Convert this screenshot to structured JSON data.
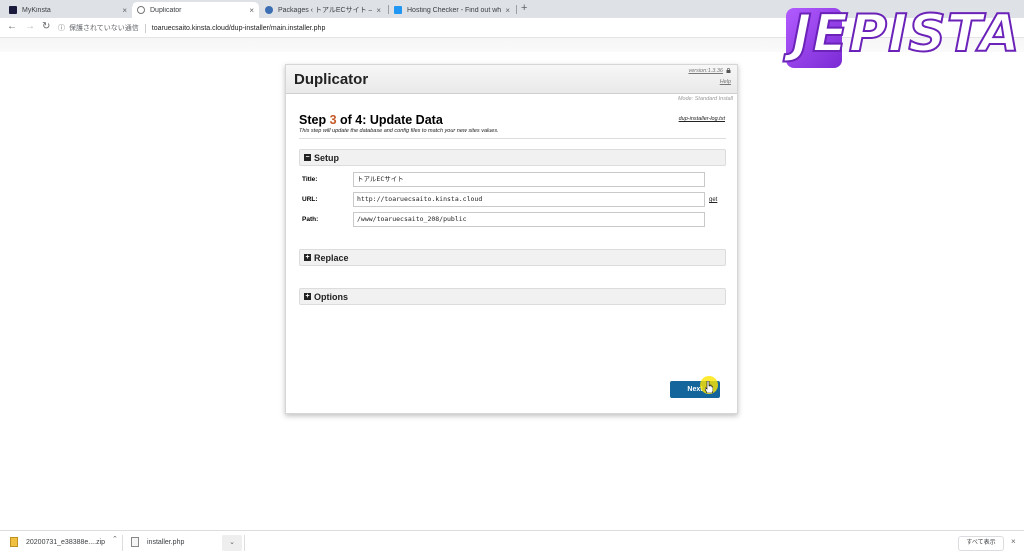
{
  "browser": {
    "tabs": [
      {
        "title": "MyKinsta",
        "fav_color": "#1a1a3d"
      },
      {
        "title": "Duplicator",
        "fav_color": "#ffffff"
      },
      {
        "title": "Packages ‹ トアルECサイト — Wor…",
        "fav_color": "#3c6eb4"
      },
      {
        "title": "Hosting Checker - Find out who…",
        "fav_color": "#2196f3"
      }
    ],
    "new_tab_icon": "plus-icon",
    "close_glyph": "×",
    "security_text": "保護されていない通信",
    "url": "toaruecsaito.kinsta.cloud/dup-installer/main.installer.php"
  },
  "logo": {
    "text": "JEPISTA"
  },
  "installer": {
    "brand": "Duplicator",
    "version": "version:1.3.36",
    "help": "Help",
    "mode": "Mode: Standard Install",
    "step_prefix": "Step ",
    "step_num": "3",
    "step_suffix": " of 4: Update Data",
    "step_desc": "This step will update the database and config files to match your new sites values.",
    "log_link": "dup-installer-log.txt",
    "sections": {
      "setup": {
        "icon": "−",
        "label": "Setup"
      },
      "replace": {
        "icon": "+",
        "label": "Replace"
      },
      "options": {
        "icon": "+",
        "label": "Options"
      }
    },
    "fields": {
      "title_label": "Title:",
      "title_value": "トアルECサイト",
      "url_label": "URL:",
      "url_value": "http://toaruecsaito.kinsta.cloud",
      "url_get": "get",
      "path_label": "Path:",
      "path_value": "/www/toaruecsaito_208/public"
    },
    "next_label": "Next"
  },
  "downloads": {
    "items": [
      {
        "name": "20200731_e38388e....zip"
      },
      {
        "name": "installer.php"
      }
    ],
    "caret": "⌃",
    "more_caret": "⌄",
    "show_all": "すべて表示",
    "close": "×"
  },
  "colors": {
    "accent": "#13659c",
    "step_num": "#c65a2a"
  }
}
